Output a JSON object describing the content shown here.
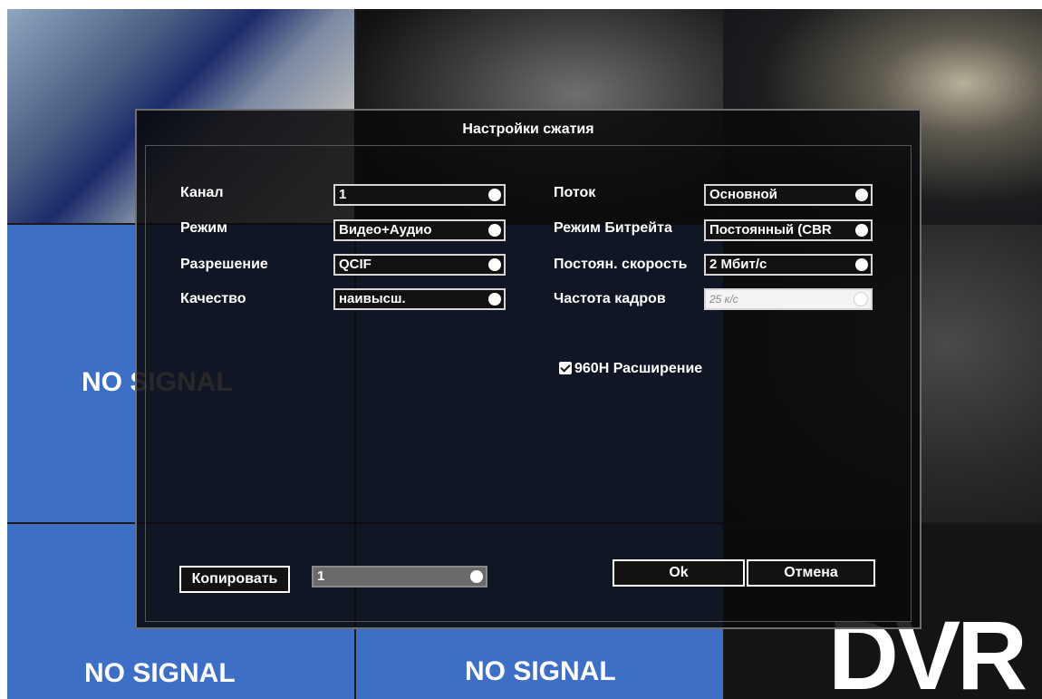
{
  "background": {
    "no_signal_text": "NO SIGNAL",
    "brand": "DVR",
    "tile_color": "#3d6fc7"
  },
  "dialog": {
    "title": "Настройки сжатия",
    "left": [
      {
        "label": "Канал",
        "value": "1"
      },
      {
        "label": "Режим",
        "value": "Видео+Аудио"
      },
      {
        "label": "Разрешение",
        "value": "QCIF"
      },
      {
        "label": "Качество",
        "value": "наивысш."
      }
    ],
    "right": [
      {
        "label": "Поток",
        "value": "Основной"
      },
      {
        "label": "Режим Битрейта",
        "value": "Постоянный (CBR"
      },
      {
        "label": "Постоян. скорость",
        "value": "2 Мбит/с"
      },
      {
        "label": "Частота кадров",
        "value": "25 к/с"
      }
    ],
    "checkbox": {
      "label": "960H Расширение",
      "checked": true
    },
    "copy_button": "Копировать",
    "copy_value": "1",
    "ok_button": "Ok",
    "cancel_button": "Отмена"
  }
}
